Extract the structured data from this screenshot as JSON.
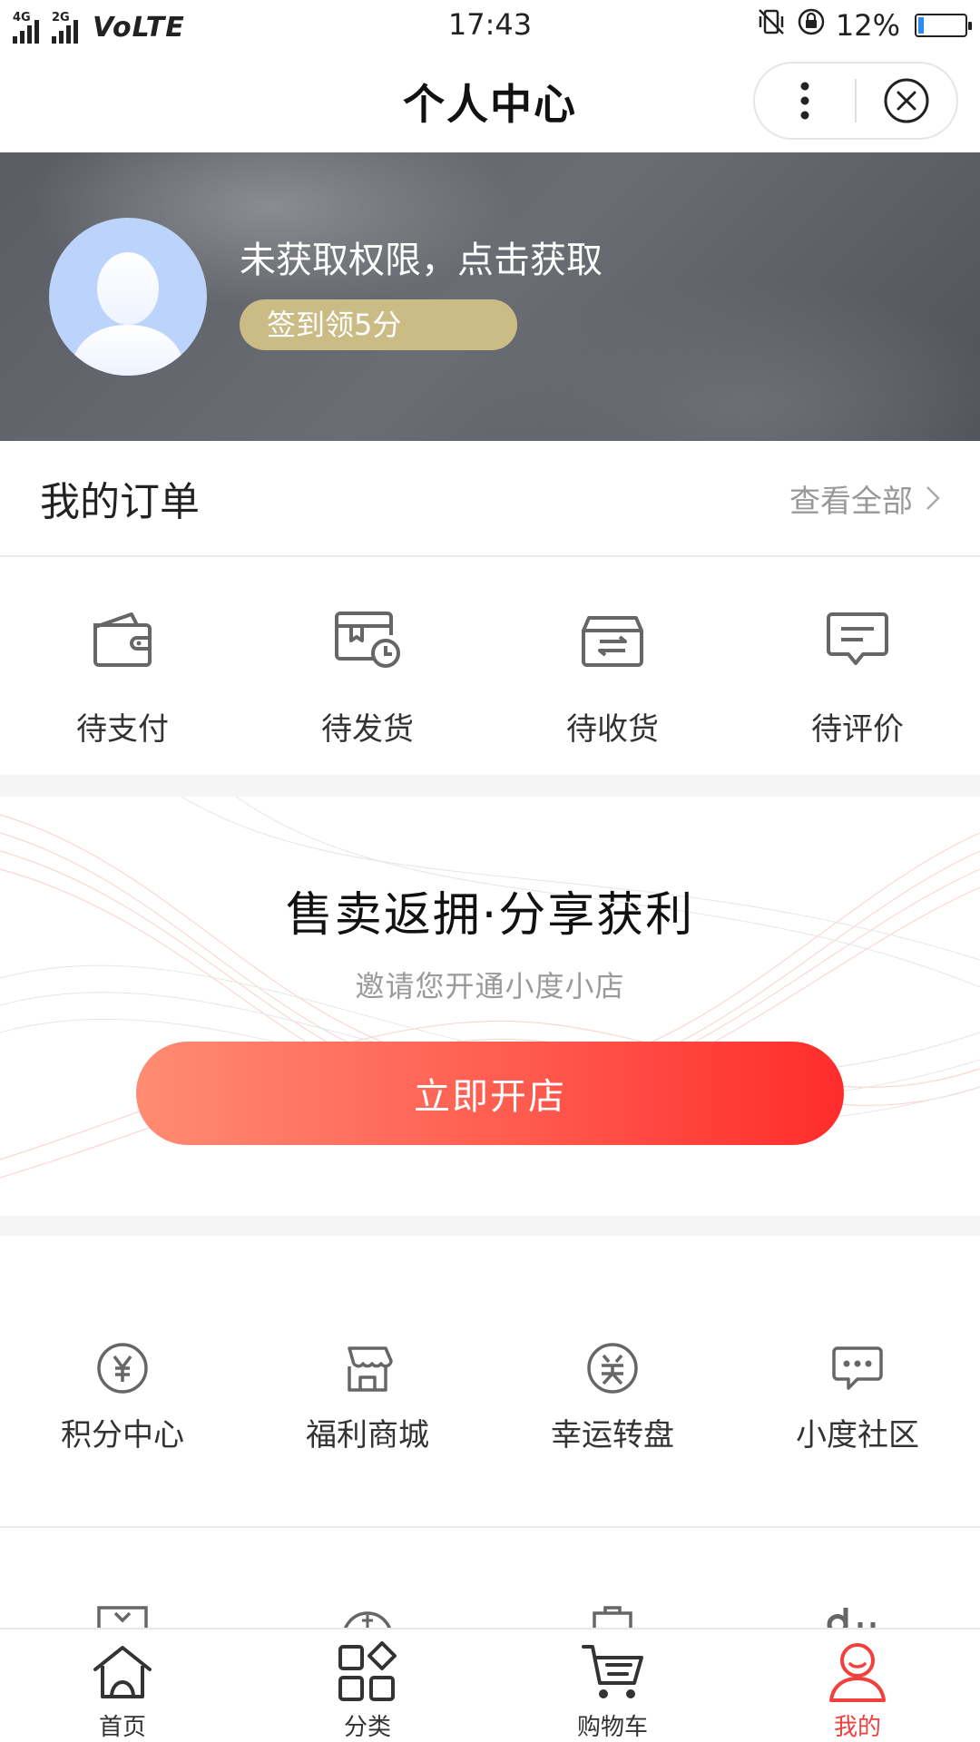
{
  "status_bar": {
    "network_primary": "4G",
    "network_secondary": "2G",
    "volte": "VoLTE",
    "time": "17:43",
    "battery_percent_text": "12%",
    "battery_level": 0.12
  },
  "header": {
    "title": "个人中心"
  },
  "profile": {
    "name": "未获取权限，点击获取",
    "checkin_label": "签到领5分"
  },
  "orders": {
    "title": "我的订单",
    "view_all": "查看全部",
    "items": [
      {
        "label": "待支付",
        "icon": "wallet-icon"
      },
      {
        "label": "待发货",
        "icon": "shipping-pending-icon"
      },
      {
        "label": "待收货",
        "icon": "receive-box-icon"
      },
      {
        "label": "待评价",
        "icon": "comment-icon"
      }
    ]
  },
  "promo": {
    "title": "售卖返拥·分享获利",
    "subtitle": "邀请您开通小度小店",
    "button": "立即开店"
  },
  "services": {
    "items": [
      {
        "label": "积分中心",
        "icon": "yen-circle-icon"
      },
      {
        "label": "福利商城",
        "icon": "storefront-icon"
      },
      {
        "label": "幸运转盘",
        "icon": "prize-icon"
      },
      {
        "label": "小度社区",
        "icon": "chat-bubble-icon"
      }
    ]
  },
  "tabbar": {
    "items": [
      {
        "label": "首页",
        "icon": "home-icon",
        "active": false
      },
      {
        "label": "分类",
        "icon": "category-icon",
        "active": false
      },
      {
        "label": "购物车",
        "icon": "cart-icon",
        "active": false
      },
      {
        "label": "我的",
        "icon": "user-icon",
        "active": true
      }
    ]
  },
  "colors": {
    "accent": "#f2403c",
    "checkin_bg": "#cbbb84",
    "avatar_bg": "#bcd3fb",
    "button_gradient_start": "#ff8c72",
    "button_gradient_end": "#ff2c2c"
  }
}
